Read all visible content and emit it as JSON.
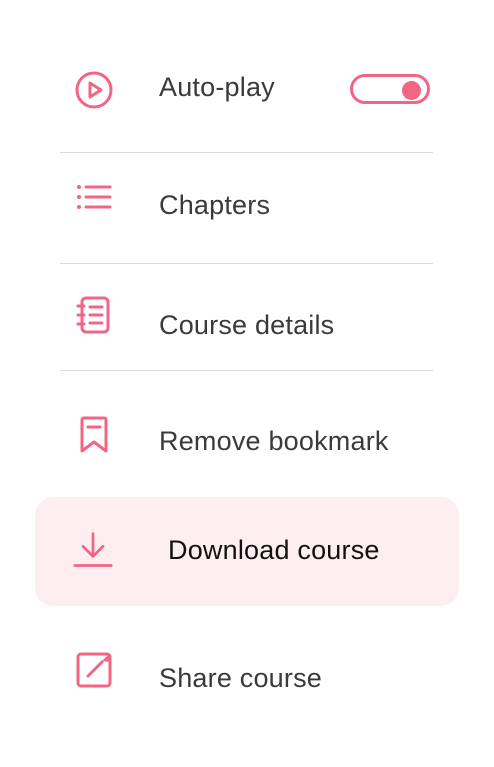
{
  "menu": {
    "autoplay": {
      "label": "Auto-play",
      "icon": "play-circle-icon",
      "enabled": true
    },
    "chapters": {
      "label": "Chapters",
      "icon": "list-icon"
    },
    "course_details": {
      "label": "Course details",
      "icon": "notebook-icon"
    },
    "remove_bookmark": {
      "label": "Remove bookmark",
      "icon": "bookmark-icon"
    },
    "download_course": {
      "label": "Download course",
      "icon": "download-icon",
      "highlighted": true
    },
    "share_course": {
      "label": "Share course",
      "icon": "share-icon"
    }
  },
  "colors": {
    "accent": "#f26585",
    "highlight_bg": "#fdeef1",
    "text": "#3a3a3c",
    "divider": "#dcdcdc"
  }
}
